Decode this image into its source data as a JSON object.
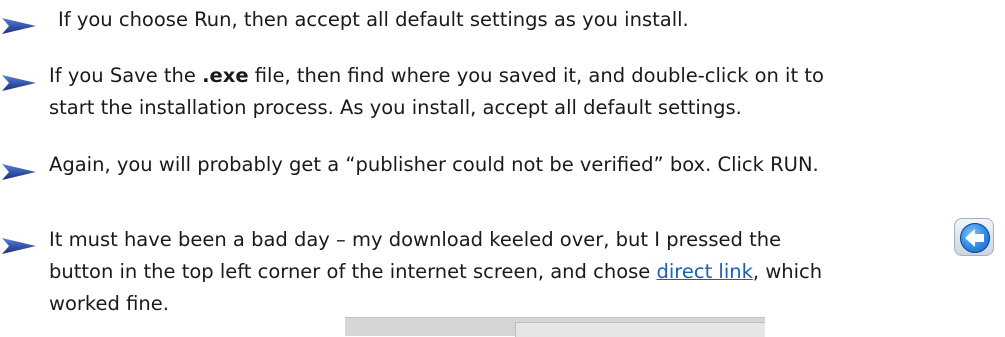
{
  "bullets": [
    {
      "lines": [
        "If you choose Run, then accept all default settings as you install."
      ]
    },
    {
      "line1_prefix": "If you Save the ",
      "line1_bold": ".exe",
      "line1_suffix": " file, then find where you saved it, and double-click on it to",
      "line2": "start the installation process. As you install, accept all default settings."
    },
    {
      "lines": [
        "Again, you will probably get a “publisher could not be verified” box.  Click RUN."
      ]
    },
    {
      "line1": "It must have been a bad day – my download keeled over, but I pressed the",
      "line2_prefix": "button in the top left corner of the internet screen, and chose ",
      "line2_link": "direct link",
      "line2_suffix": ", which",
      "line3": "worked fine."
    }
  ],
  "icons": {
    "bullet": "blue-arrow-bullet-icon",
    "back_button": "back-arrow-icon"
  },
  "colors": {
    "bullet_arrow": "#1f3f9a",
    "link": "#1a5fb4",
    "back_button_blue": "#2a86e0"
  }
}
